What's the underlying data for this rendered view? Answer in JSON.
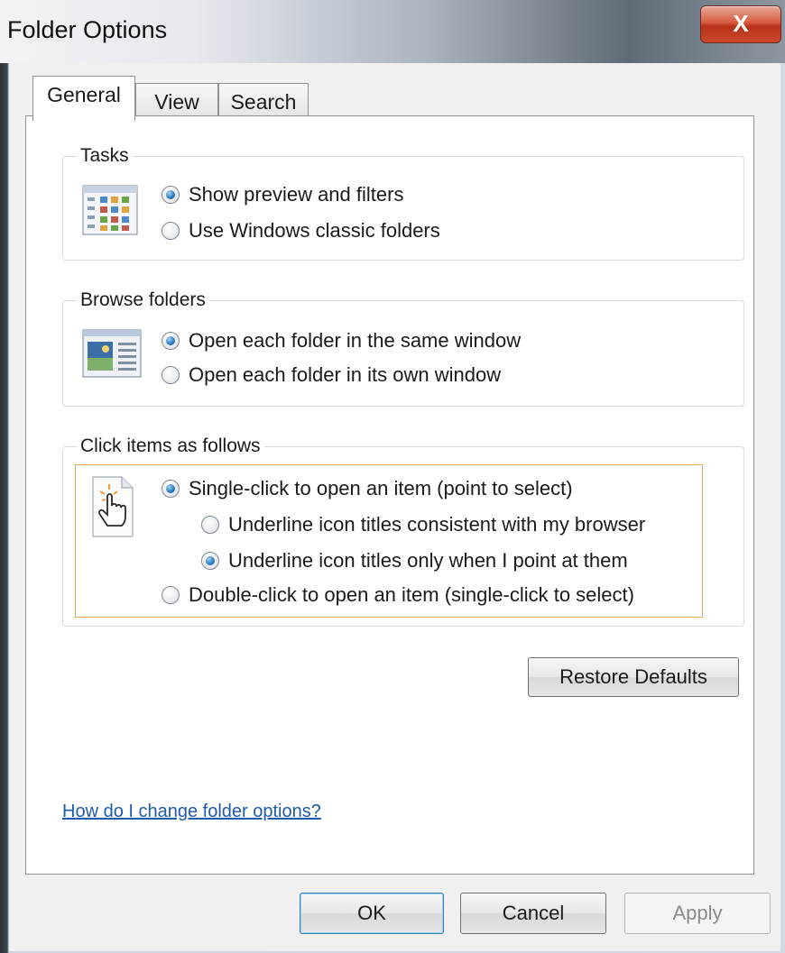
{
  "window": {
    "title": "Folder Options",
    "close_label": "X"
  },
  "tabs": [
    {
      "label": "General",
      "active": true
    },
    {
      "label": "View",
      "active": false
    },
    {
      "label": "Search",
      "active": false
    }
  ],
  "tasks": {
    "legend": "Tasks",
    "icon": "preview-filters-icon",
    "options": [
      {
        "label": "Show preview and filters",
        "checked": true
      },
      {
        "label": "Use Windows classic folders",
        "checked": false
      }
    ]
  },
  "browse": {
    "legend": "Browse folders",
    "icon": "same-window-icon",
    "options": [
      {
        "label": "Open each folder in the same window",
        "checked": true
      },
      {
        "label": "Open each folder in its own window",
        "checked": false
      }
    ]
  },
  "click": {
    "legend": "Click items as follows",
    "icon": "hand-pointer-icon",
    "options": [
      {
        "label": "Single-click to open an item (point to select)",
        "checked": true
      },
      {
        "label": "Underline icon titles consistent with my browser",
        "checked": false
      },
      {
        "label": "Underline icon titles only when I point at them",
        "checked": true
      },
      {
        "label": "Double-click to open an item (single-click to select)",
        "checked": false
      }
    ]
  },
  "buttons": {
    "restore": "Restore Defaults",
    "ok": "OK",
    "cancel": "Cancel",
    "apply": "Apply"
  },
  "help_link": "How do I change folder options?",
  "colors": {
    "focus_border": "#e8a756",
    "link": "#1e5aa8",
    "close": "#c9472a"
  }
}
